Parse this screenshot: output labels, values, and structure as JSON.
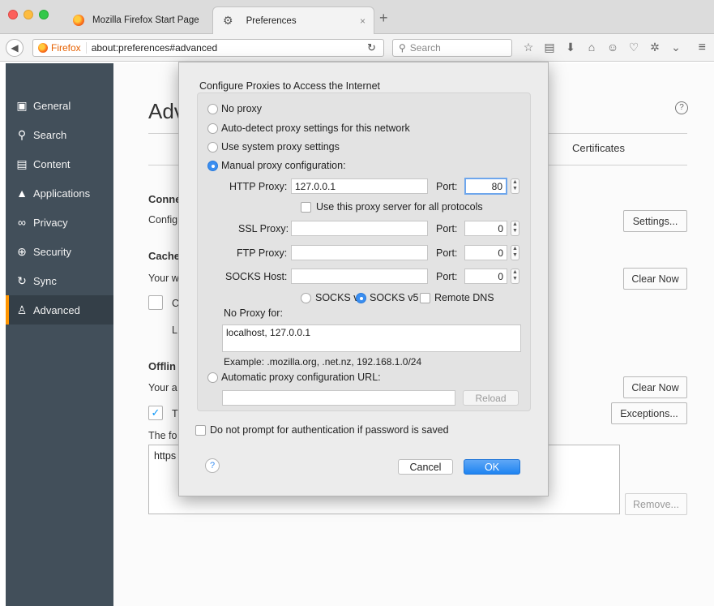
{
  "browser": {
    "tabs": [
      {
        "title": "Mozilla Firefox Start Page",
        "close": "×"
      },
      {
        "title": "Preferences",
        "close": "×"
      }
    ],
    "new_tab": "+",
    "url_identity": "Firefox",
    "url": "about:preferences#advanced",
    "search_placeholder": "Search"
  },
  "sidebar": {
    "items": [
      {
        "label": "General",
        "icon": "general-icon"
      },
      {
        "label": "Search",
        "icon": "search-icon"
      },
      {
        "label": "Content",
        "icon": "content-icon"
      },
      {
        "label": "Applications",
        "icon": "applications-icon"
      },
      {
        "label": "Privacy",
        "icon": "privacy-icon"
      },
      {
        "label": "Security",
        "icon": "security-icon"
      },
      {
        "label": "Sync",
        "icon": "sync-icon"
      },
      {
        "label": "Advanced",
        "icon": "advanced-icon",
        "active": true
      }
    ],
    "active_color": "#ff9500"
  },
  "background": {
    "title": "Adv",
    "tab_certificates": "Certificates",
    "connection_heading": "Conne",
    "connection_text": "Config",
    "settings_button": "Settings...",
    "cache_heading": "Cache",
    "cache_text": "Your w",
    "cache_check_label": "C",
    "cache_sub": "L",
    "clear_now_1": "Clear Now",
    "offline_heading": "Offlin",
    "offline_text": "Your a",
    "clear_now_2": "Clear Now",
    "tell_check_label": "T",
    "exceptions_button": "Exceptions...",
    "following_text": "The fo",
    "list_item": "https",
    "remove_button": "Remove..."
  },
  "dialog": {
    "title": "Configure Proxies to Access the Internet",
    "options": {
      "no_proxy": "No proxy",
      "auto_detect": "Auto-detect proxy settings for this network",
      "system": "Use system proxy settings",
      "manual": "Manual proxy configuration:",
      "auto_url": "Automatic proxy configuration URL:"
    },
    "selected_option": "manual",
    "http_label": "HTTP Proxy:",
    "http_value": "127.0.0.1",
    "http_port": "80",
    "same_proxy_label": "Use this proxy server for all protocols",
    "ssl_label": "SSL Proxy:",
    "ssl_value": "",
    "ssl_port": "0",
    "ftp_label": "FTP Proxy:",
    "ftp_value": "",
    "ftp_port": "0",
    "socks_label": "SOCKS Host:",
    "socks_value": "",
    "socks_port": "0",
    "port_label": "Port:",
    "socks_v4": "SOCKS v4",
    "socks_v5": "SOCKS v5",
    "socks_version_selected": "v5",
    "remote_dns": "Remote DNS",
    "no_proxy_label": "No Proxy for:",
    "no_proxy_value": "localhost, 127.0.0.1",
    "example": "Example: .mozilla.org, .net.nz, 192.168.1.0/24",
    "auto_url_value": "",
    "reload_button": "Reload",
    "no_prompt_label": "Do not prompt for authentication if password is saved",
    "help": "?",
    "cancel_button": "Cancel",
    "ok_button": "OK",
    "accent_color": "#3a8ef0"
  }
}
